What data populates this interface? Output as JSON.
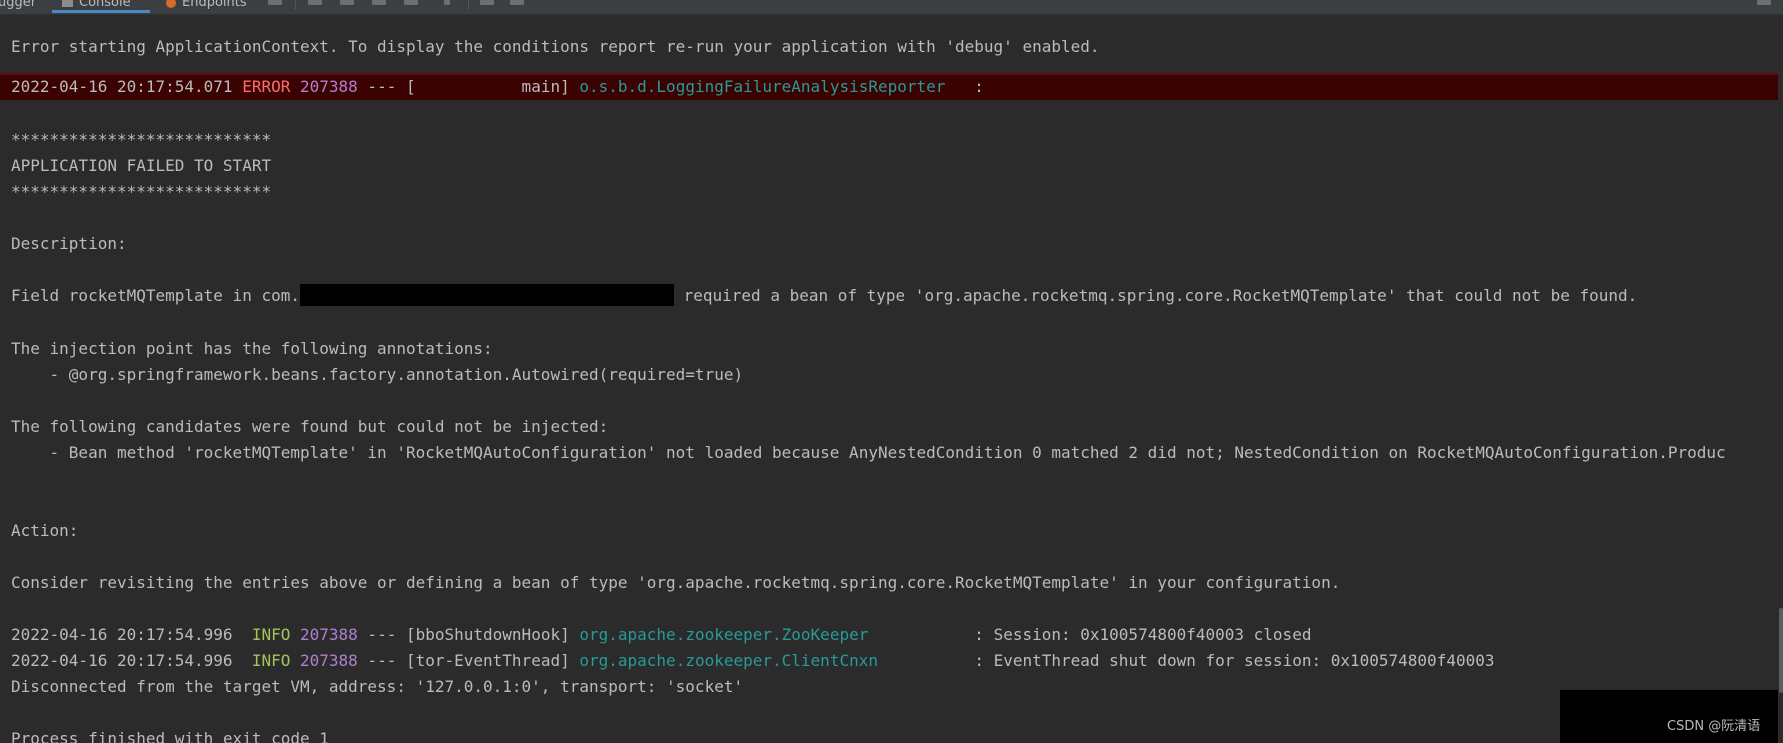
{
  "toolbar": {
    "tabs": [
      {
        "label": "ugger"
      },
      {
        "label": "Console"
      },
      {
        "label": "Endpoints"
      }
    ]
  },
  "colors": {
    "background": "#2b2b2b",
    "error_line_bg": "#3b0202",
    "error_level": "#ff6b68",
    "info_level": "#a5c25c",
    "pid": "#b07fd0",
    "logger": "#299999",
    "text": "#bbbbbb"
  },
  "console": {
    "lines": [
      {
        "text": "Error starting ApplicationContext. To display the conditions report re-run your application with 'debug' enabled."
      },
      {
        "ts": "2022-04-16 20:17:54.071 ",
        "level": "ERROR",
        "pid": " 207388",
        "sep": " --- [           main] ",
        "logger": "o.s.b.d.LoggingFailureAnalysisReporter",
        "msg": "   :"
      },
      {
        "text": "***************************"
      },
      {
        "text": "APPLICATION FAILED TO START"
      },
      {
        "text": "***************************"
      },
      {
        "text": "Description:"
      },
      {
        "pre": "Field rocketMQTemplate in com.",
        "post": " required a bean of type 'org.apache.rocketmq.spring.core.RocketMQTemplate' that could not be found."
      },
      {
        "text": "The injection point has the following annotations:"
      },
      {
        "text": "    - @org.springframework.beans.factory.annotation.Autowired(required=true)"
      },
      {
        "text": "The following candidates were found but could not be injected:"
      },
      {
        "text": "    - Bean method 'rocketMQTemplate' in 'RocketMQAutoConfiguration' not loaded because AnyNestedCondition 0 matched 2 did not; NestedCondition on RocketMQAutoConfiguration.Produc"
      },
      {
        "text": "Action:"
      },
      {
        "text": "Consider revisiting the entries above or defining a bean of type 'org.apache.rocketmq.spring.core.RocketMQTemplate' in your configuration."
      },
      {
        "ts": "2022-04-16 20:17:54.996  ",
        "level": "INFO",
        "pid": " 207388",
        "sep": " --- [bboShutdownHook] ",
        "logger": "org.apache.zookeeper.ZooKeeper",
        "msg": "           : Session: 0x100574800f40003 closed"
      },
      {
        "ts": "2022-04-16 20:17:54.996  ",
        "level": "INFO",
        "pid": " 207388",
        "sep": " --- [tor-EventThread] ",
        "logger": "org.apache.zookeeper.ClientCnxn",
        "msg": "          : EventThread shut down for session: 0x100574800f40003"
      },
      {
        "text": "Disconnected from the target VM, address: '127.0.0.1:0', transport: 'socket'"
      },
      {
        "text": "Process finished with exit code 1"
      }
    ]
  },
  "watermark": "CSDN @阮清语"
}
